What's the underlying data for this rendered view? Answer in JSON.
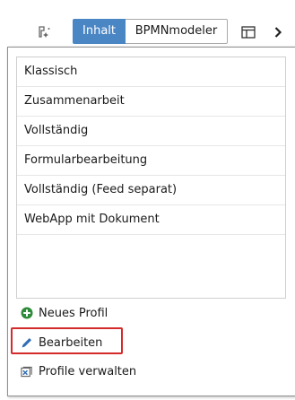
{
  "toolbar": {
    "left_icon": "schema-sparkle-icon",
    "tabs": [
      {
        "label": "Inhalt",
        "active": true
      },
      {
        "label": "BPMNmodeler",
        "active": false
      }
    ],
    "layout_icon": "window-layout-icon",
    "next_icon": "chevron-right-icon",
    "accent_color": "#4a86c4"
  },
  "panel": {
    "profiles": [
      {
        "label": "Klassisch"
      },
      {
        "label": "Zusammenarbeit"
      },
      {
        "label": "Vollständig"
      },
      {
        "label": "Formularbearbeitung"
      },
      {
        "label": "Vollständig (Feed separat)"
      },
      {
        "label": "WebApp mit Dokument"
      }
    ],
    "actions": {
      "new_profile": {
        "label": "Neues Profil",
        "icon": "plus-circle-icon",
        "color": "#2e8b3a"
      },
      "edit": {
        "label": "Bearbeiten",
        "icon": "pencil-icon",
        "color": "#2f6db5"
      },
      "manage": {
        "label": "Profile verwalten",
        "icon": "manage-profiles-icon",
        "color": "#2f6db5"
      }
    },
    "highlight_color": "#d42a2a"
  }
}
